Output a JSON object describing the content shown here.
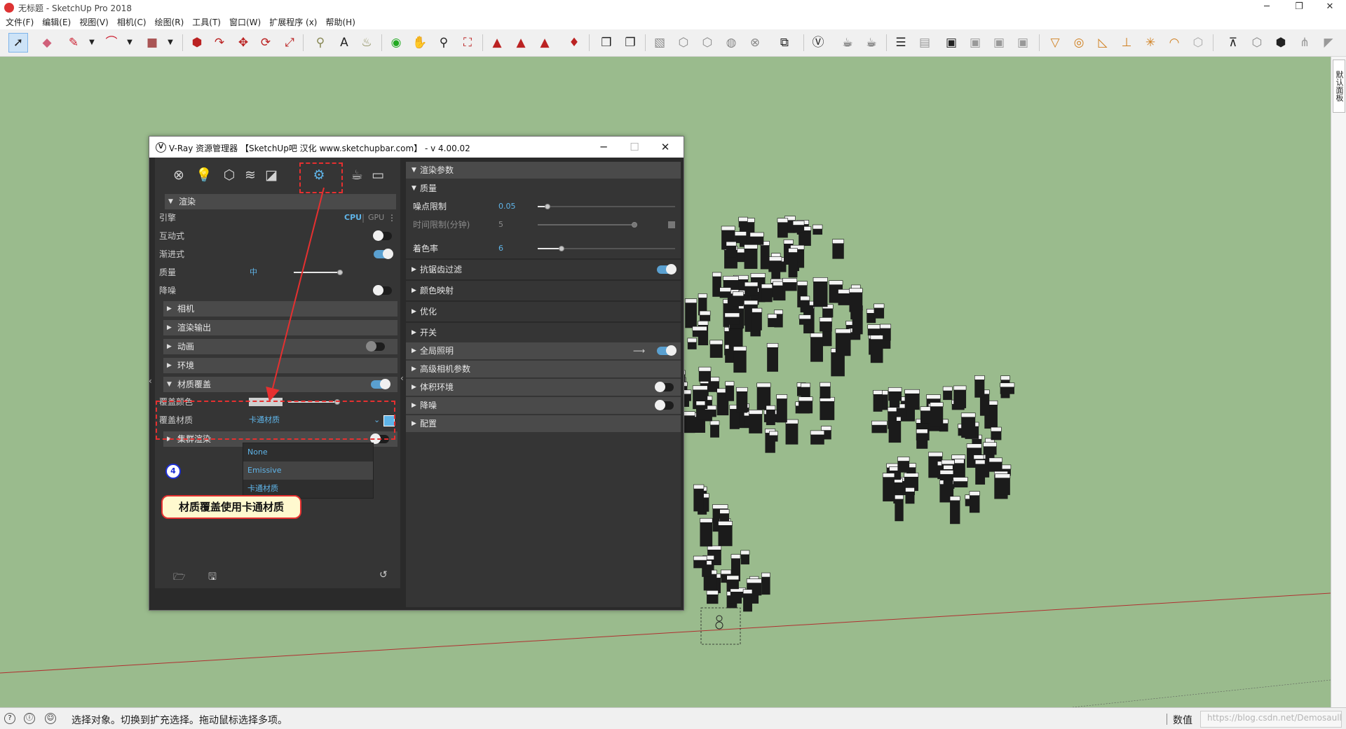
{
  "window": {
    "title": "无标题 - SketchUp Pro 2018",
    "buttons": {
      "minimize": "─",
      "restore": "❐",
      "close": "✕"
    }
  },
  "menu": [
    "文件(F)",
    "编辑(E)",
    "视图(V)",
    "相机(C)",
    "绘图(R)",
    "工具(T)",
    "窗口(W)",
    "扩展程序 (x)",
    "帮助(H)"
  ],
  "right_tab": "默认面板",
  "status": {
    "message": "选择对象。切换到扩充选择。拖动鼠标选择多项。",
    "value_label": "数值",
    "watermark": "https://blog.csdn.net/Demosaull"
  },
  "colors": {
    "viewport": "#9abb8d",
    "accent": "#5fb4e8",
    "annotation": "#e53030"
  },
  "vray": {
    "title": "V-Ray 资源管理器 【SketchUp吧 汉化 www.sketchupbar.com】 - v 4.00.02",
    "left": {
      "render_header": "渲染",
      "engine_label": "引擎",
      "cpu": "CPU",
      "gpu": "GPU",
      "interactive_label": "互动式",
      "progressive_label": "渐进式",
      "quality_label": "质量",
      "quality_value": "中",
      "denoise_label": "降噪",
      "camera": "相机",
      "render_output": "渲染输出",
      "animation": "动画",
      "environment": "环境",
      "material_override": "材质覆盖",
      "override_color": "覆盖颜色",
      "override_material": "覆盖材质",
      "override_material_value": "卡通材质",
      "swarm": "集群渲染",
      "dropdown_options": [
        "None",
        "Emissive",
        "卡通材质"
      ],
      "toggles": {
        "interactive": false,
        "progressive": true,
        "denoise": false,
        "animation": false,
        "material_override": true,
        "swarm": false
      }
    },
    "right": {
      "render_params": "渲染参数",
      "quality": "质量",
      "noise_limit_label": "噪点限制",
      "noise_limit_value": "0.05",
      "time_limit_label": "时间限制(分钟)",
      "time_limit_value": "5",
      "shading_rate_label": "着色率",
      "shading_rate_value": "6",
      "antialiasing": "抗锯齿过滤",
      "color_mapping": "颜色映射",
      "optimize": "优化",
      "switches": "开关",
      "gi": "全局照明",
      "advanced_camera": "高级相机参数",
      "volumetric": "体积环境",
      "denoise": "降噪",
      "config": "配置",
      "toggles": {
        "antialiasing": true,
        "gi": true,
        "volumetric": false,
        "denoise": false
      }
    }
  },
  "annotation": {
    "step": "4",
    "callout": "材质覆盖使用卡通材质"
  }
}
